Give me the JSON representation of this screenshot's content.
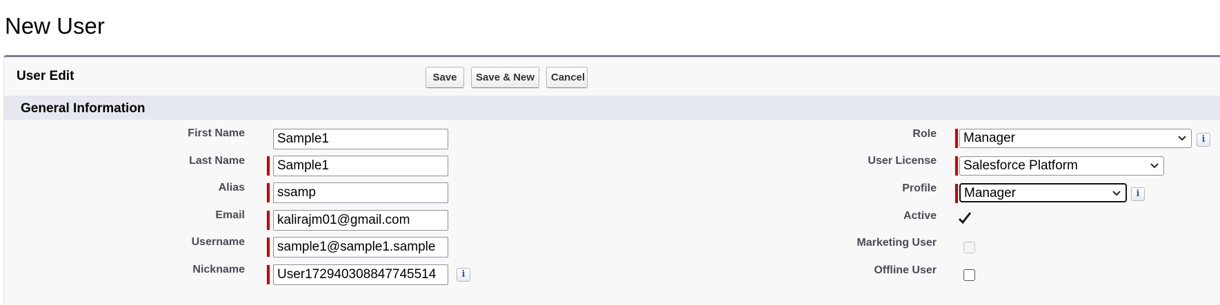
{
  "page": {
    "title": "New User"
  },
  "panel": {
    "title": "User Edit",
    "buttons": {
      "save": "Save",
      "save_new": "Save & New",
      "cancel": "Cancel"
    },
    "section_title": "General Information"
  },
  "left_fields": {
    "first_name": {
      "label": "First Name",
      "value": "Sample1",
      "required": false
    },
    "last_name": {
      "label": "Last Name",
      "value": "Sample1",
      "required": true
    },
    "alias": {
      "label": "Alias",
      "value": "ssamp",
      "required": true
    },
    "email": {
      "label": "Email",
      "value": "kalirajm01@gmail.com",
      "required": true
    },
    "username": {
      "label": "Username",
      "value": "sample1@sample1.sample",
      "required": true
    },
    "nickname": {
      "label": "Nickname",
      "value": "User172940308847745514",
      "required": true,
      "info_icon": "info-icon"
    }
  },
  "right_fields": {
    "role": {
      "label": "Role",
      "value": "Manager",
      "required": true,
      "info_icon": "info-icon"
    },
    "user_license": {
      "label": "User License",
      "value": "Salesforce Platform",
      "required": true
    },
    "profile": {
      "label": "Profile",
      "value": "Manager",
      "required": true,
      "focused": true,
      "info_icon": "info-icon"
    },
    "active": {
      "label": "Active",
      "checked": true
    },
    "marketing_user": {
      "label": "Marketing User",
      "checked": false,
      "disabled": true
    },
    "offline_user": {
      "label": "Offline User",
      "checked": false
    }
  },
  "icons": {
    "info_glyph": "i",
    "chevron": "chevron-down-icon",
    "checkmark": "checkmark-icon"
  },
  "colors": {
    "panel_border": "#747e96",
    "section_bg": "#e5e8f0",
    "required_bar": "#c00000",
    "label_text": "#4a4a56",
    "panel_bg": "#f8f8f8"
  }
}
